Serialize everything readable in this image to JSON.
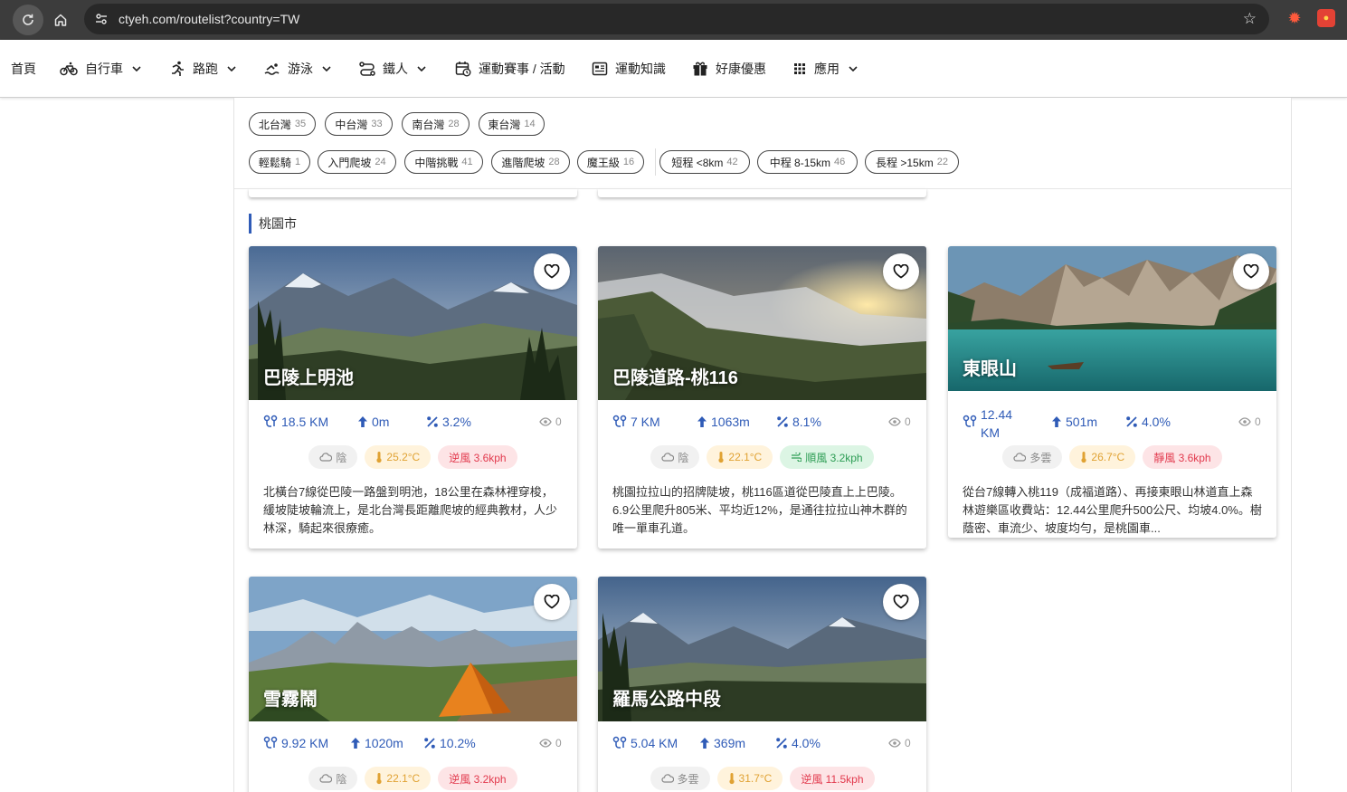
{
  "browser": {
    "url": "ctyeh.com/routelist?country=TW"
  },
  "nav": {
    "home": "首頁",
    "cycling": "自行車",
    "running": "路跑",
    "swimming": "游泳",
    "triathlon": "鐵人",
    "events": "運動賽事 / 活動",
    "knowledge": "運動知識",
    "deals": "好康優惠",
    "apps": "應用"
  },
  "filters": {
    "regions": [
      {
        "label": "北台灣",
        "count": "35"
      },
      {
        "label": "中台灣",
        "count": "33"
      },
      {
        "label": "南台灣",
        "count": "28"
      },
      {
        "label": "東台灣",
        "count": "14"
      }
    ],
    "difficulty": [
      {
        "label": "輕鬆騎",
        "count": "1"
      },
      {
        "label": "入門爬坡",
        "count": "24"
      },
      {
        "label": "中階挑戰",
        "count": "41"
      },
      {
        "label": "進階爬坡",
        "count": "28"
      },
      {
        "label": "魔王級",
        "count": "16"
      }
    ],
    "distance": [
      {
        "label": "短程 <8km",
        "count": "42"
      },
      {
        "label": "中程 8-15km",
        "count": "46"
      },
      {
        "label": "長程 >15km",
        "count": "22"
      }
    ]
  },
  "section": {
    "title": "桃園市"
  },
  "routes": [
    {
      "title": "巴陵上明池",
      "distance": "18.5 KM",
      "elevation": "0m",
      "grade": "3.2%",
      "views": "0",
      "sky": "陰",
      "temp": "25.2°C",
      "wind": "逆風 3.6kph",
      "desc": "北橫台7線從巴陵一路盤到明池，18公里在森林裡穿梭，緩坡陡坡輪流上，是北台灣長距離爬坡的經典教材，人少林深，騎起來很療癒。"
    },
    {
      "title": "巴陵道路-桃116",
      "distance": "7 KM",
      "elevation": "1063m",
      "grade": "8.1%",
      "views": "0",
      "sky": "陰",
      "temp": "22.1°C",
      "wind": "順風 3.2kph",
      "desc": "桃園拉拉山的招牌陡坡，桃116區道從巴陵直上上巴陵。6.9公里爬升805米、平均近12%，是通往拉拉山神木群的唯一單車孔道。"
    },
    {
      "title": "東眼山",
      "distance": "12.44 KM",
      "elevation": "501m",
      "grade": "4.0%",
      "views": "0",
      "sky": "多雲",
      "temp": "26.7°C",
      "wind": "靜風 3.6kph",
      "desc": "從台7線轉入桃119（成福道路）、再接東眼山林道直上森林遊樂區收費站：12.44公里爬升500公尺、均坡4.0%。樹蔭密、車流少、坡度均勻，是桃園車..."
    },
    {
      "title": "雪霧鬧",
      "distance": "9.92 KM",
      "elevation": "1020m",
      "grade": "10.2%",
      "views": "0",
      "sky": "陰",
      "temp": "22.1°C",
      "wind": "逆風 3.2kph",
      "desc": ""
    },
    {
      "title": "羅馬公路中段",
      "distance": "5.04 KM",
      "elevation": "369m",
      "grade": "4.0%",
      "views": "0",
      "sky": "多雲",
      "temp": "31.7°C",
      "wind": "逆風 11.5kph",
      "desc": ""
    }
  ]
}
